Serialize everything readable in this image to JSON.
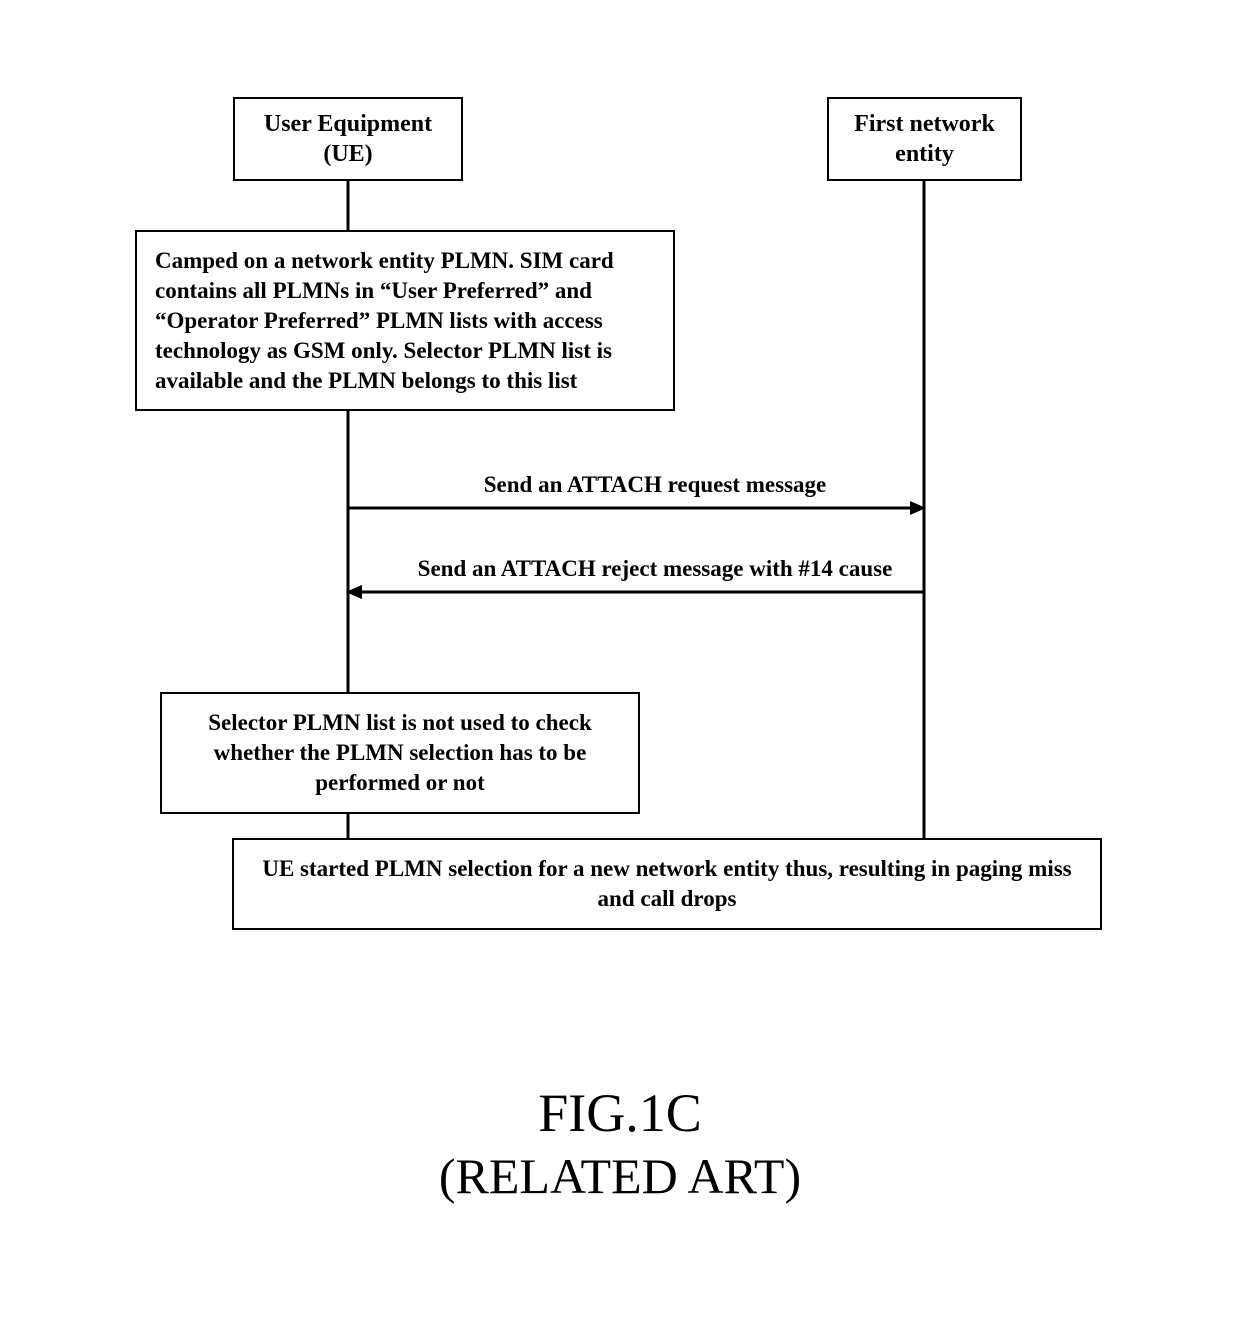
{
  "headers": {
    "ue": "User Equipment (UE)",
    "net": "First network entity"
  },
  "boxes": {
    "camped": "Camped on a network entity PLMN. SIM card contains all PLMNs in “User Preferred” and “Operator Preferred” PLMN lists with access technology as GSM only. Selector PLMN list is available and the PLMN belongs to this list",
    "selector": "Selector PLMN list is not used to check whether the PLMN selection has to be performed or not",
    "result": "UE started PLMN selection for a new network entity thus, resulting in paging miss and call drops"
  },
  "messages": {
    "attach_request": "Send an ATTACH request message",
    "attach_reject": "Send an ATTACH reject message with #14 cause"
  },
  "figure": {
    "title": "FIG.1C",
    "subtitle": "(RELATED ART)"
  }
}
